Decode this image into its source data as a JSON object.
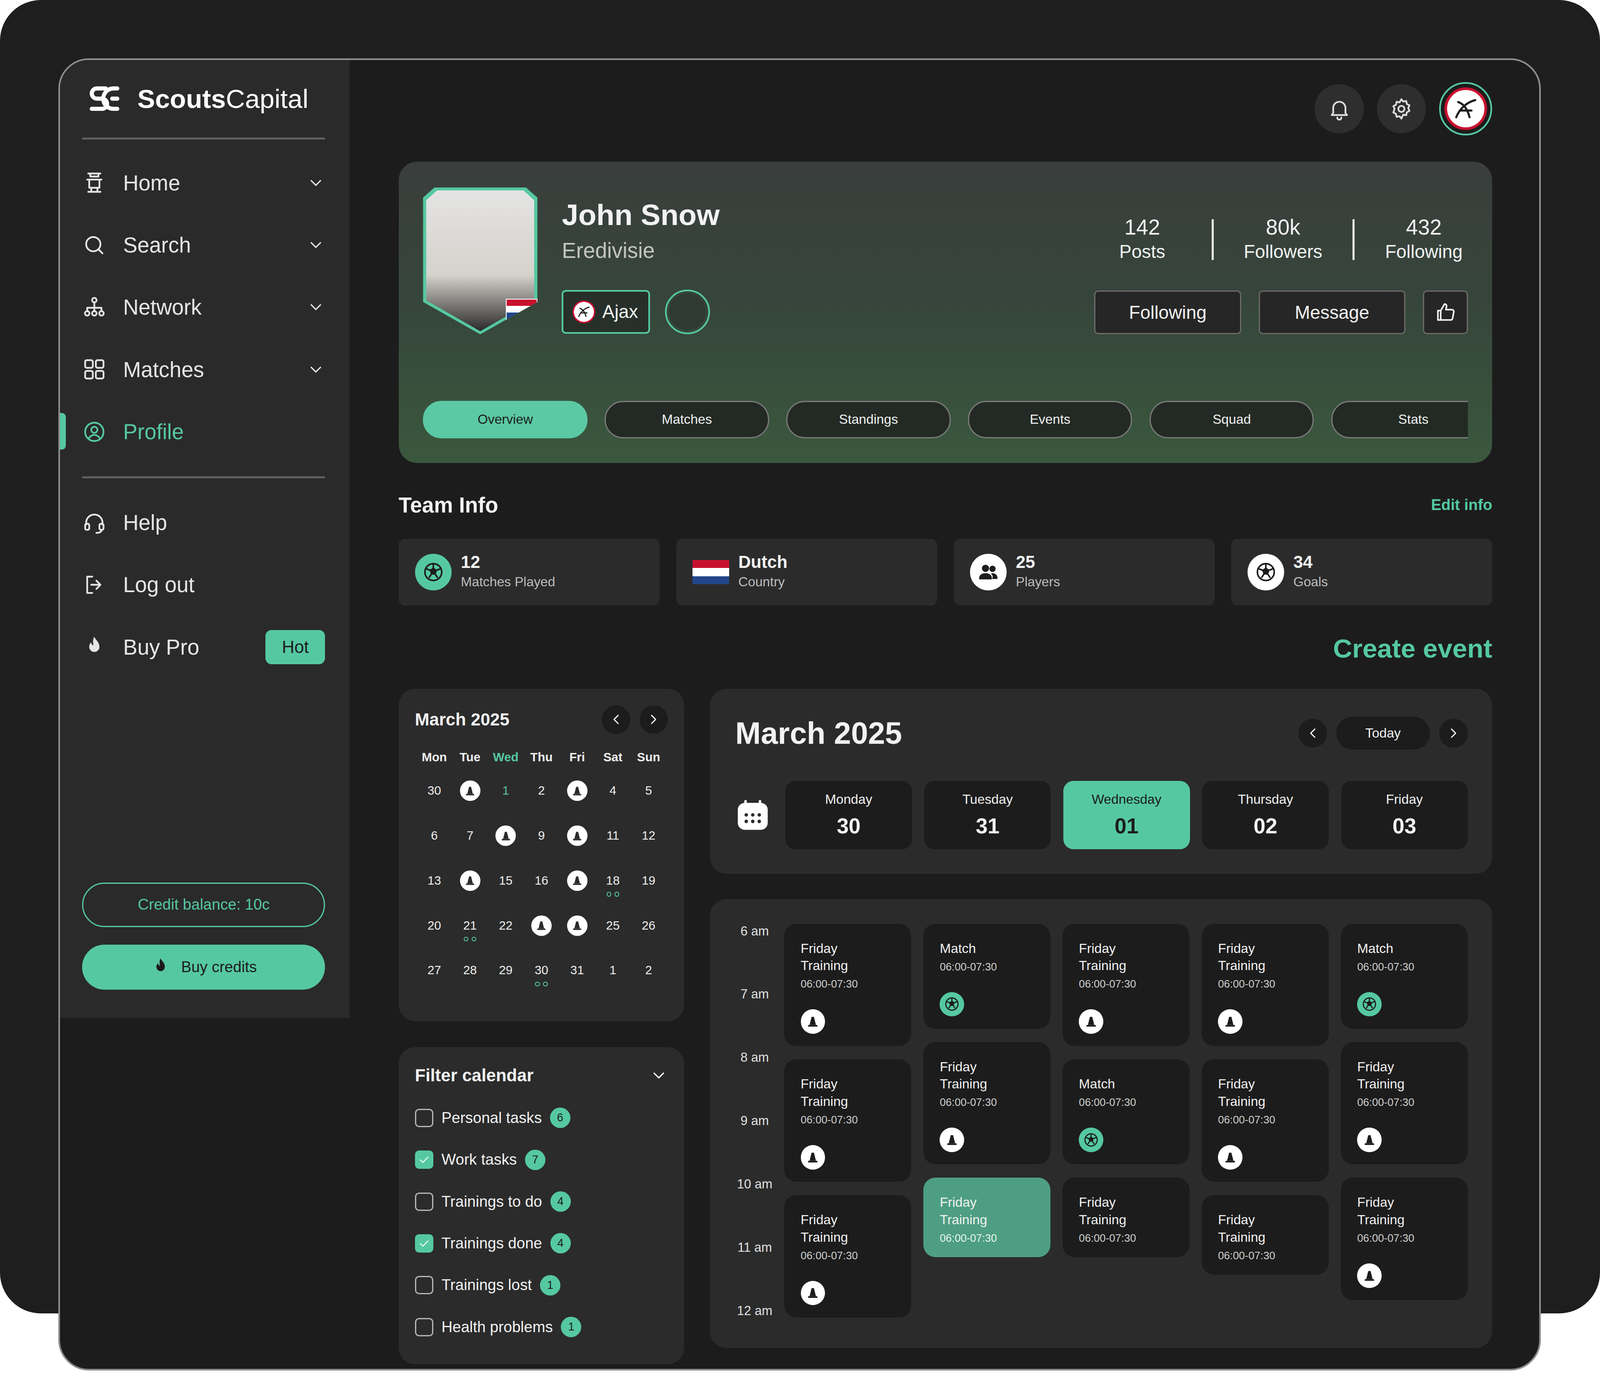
{
  "brand": {
    "bold": "Scouts",
    "light": "Capital"
  },
  "sidebar": {
    "nav": [
      {
        "label": "Home",
        "kind": "menu",
        "selected": false
      },
      {
        "label": "Search",
        "kind": "menu",
        "selected": false
      },
      {
        "label": "Network",
        "kind": "menu",
        "selected": false
      },
      {
        "label": "Matches",
        "kind": "menu",
        "selected": false
      },
      {
        "label": "Profile",
        "kind": "link",
        "selected": true
      }
    ],
    "secondary": [
      {
        "label": "Help"
      },
      {
        "label": "Log out"
      },
      {
        "label": "Buy Pro",
        "badge": "Hot"
      }
    ],
    "credit_balance": "Credit balance: 10c",
    "buy_button": "Buy credits"
  },
  "profile": {
    "name": "John Snow",
    "league": "Eredivisie",
    "club": "Ajax",
    "stats": [
      {
        "value": "142",
        "label": "Posts"
      },
      {
        "value": "80k",
        "label": "Followers"
      },
      {
        "value": "432",
        "label": "Following"
      }
    ],
    "actions": [
      "Following",
      "Message"
    ],
    "tabs": [
      {
        "label": "Overview",
        "selected": true
      },
      {
        "label": "Matches",
        "selected": false
      },
      {
        "label": "Standings",
        "selected": false
      },
      {
        "label": "Events",
        "selected": false
      },
      {
        "label": "Squad",
        "selected": false
      },
      {
        "label": "Stats",
        "selected": false
      }
    ]
  },
  "team_info": {
    "title": "Team Info",
    "edit": "Edit info",
    "cards": [
      {
        "value": "12",
        "label": "Matches Played"
      },
      {
        "value": "Dutch",
        "label": "Country"
      },
      {
        "value": "25",
        "label": "Players"
      },
      {
        "value": "34",
        "label": "Goals"
      }
    ]
  },
  "create_event": "Create event",
  "mini_calendar": {
    "title": "March 2025",
    "weekdays": [
      {
        "label": "Mon",
        "selected": false
      },
      {
        "label": "Tue",
        "selected": false
      },
      {
        "label": "Wed",
        "selected": true
      },
      {
        "label": "Thu",
        "selected": false
      },
      {
        "label": "Fri",
        "selected": false
      },
      {
        "label": "Sat",
        "selected": false
      },
      {
        "label": "Sun",
        "selected": false
      }
    ],
    "weeks": [
      [
        {
          "label": "30",
          "kind": "date",
          "selected": false,
          "dots": false
        },
        {
          "kind": "event",
          "selected": false,
          "dots": false
        },
        {
          "label": "1",
          "kind": "date",
          "selected": true,
          "dots": false
        },
        {
          "label": "2",
          "kind": "date",
          "selected": false,
          "dots": false
        },
        {
          "kind": "event",
          "selected": false,
          "dots": false
        },
        {
          "label": "4",
          "kind": "date",
          "selected": false,
          "dots": false
        },
        {
          "label": "5",
          "kind": "date",
          "selected": false,
          "dots": false
        }
      ],
      [
        {
          "label": "6",
          "kind": "date",
          "selected": false,
          "dots": false
        },
        {
          "label": "7",
          "kind": "date",
          "selected": false,
          "dots": false
        },
        {
          "kind": "event",
          "selected": false,
          "dots": false
        },
        {
          "label": "9",
          "kind": "date",
          "selected": false,
          "dots": false
        },
        {
          "kind": "event",
          "selected": false,
          "dots": false
        },
        {
          "label": "11",
          "kind": "date",
          "selected": false,
          "dots": false
        },
        {
          "label": "12",
          "kind": "date",
          "selected": false,
          "dots": false
        }
      ],
      [
        {
          "label": "13",
          "kind": "date",
          "selected": false,
          "dots": false
        },
        {
          "kind": "event",
          "selected": false,
          "dots": false
        },
        {
          "label": "15",
          "kind": "date",
          "selected": false,
          "dots": false
        },
        {
          "label": "16",
          "kind": "date",
          "selected": false,
          "dots": false
        },
        {
          "kind": "event",
          "selected": false,
          "dots": false
        },
        {
          "label": "18",
          "kind": "date",
          "selected": false,
          "dots": true
        },
        {
          "label": "19",
          "kind": "date",
          "selected": false,
          "dots": false
        }
      ],
      [
        {
          "label": "20",
          "kind": "date",
          "selected": false,
          "dots": false
        },
        {
          "label": "21",
          "kind": "date",
          "selected": false,
          "dots": true
        },
        {
          "label": "22",
          "kind": "date",
          "selected": false,
          "dots": false
        },
        {
          "kind": "event",
          "selected": false,
          "dots": false
        },
        {
          "kind": "event",
          "selected": false,
          "dots": false
        },
        {
          "label": "25",
          "kind": "date",
          "selected": false,
          "dots": false
        },
        {
          "label": "26",
          "kind": "date",
          "selected": false,
          "dots": false
        }
      ],
      [
        {
          "label": "27",
          "kind": "date",
          "selected": false,
          "dots": false
        },
        {
          "label": "28",
          "kind": "date",
          "selected": false,
          "dots": false
        },
        {
          "label": "29",
          "kind": "date",
          "selected": false,
          "dots": false
        },
        {
          "label": "30",
          "kind": "date",
          "selected": false,
          "dots": true
        },
        {
          "label": "31",
          "kind": "date",
          "selected": false,
          "dots": false
        },
        {
          "label": "1",
          "kind": "date",
          "selected": false,
          "dots": false
        },
        {
          "label": "2",
          "kind": "date",
          "selected": false,
          "dots": false
        }
      ]
    ]
  },
  "filters": {
    "title": "Filter calendar",
    "expanded": true,
    "items": [
      {
        "label": "Personal tasks",
        "count": "6",
        "checked": false
      },
      {
        "label": "Work tasks",
        "count": "7",
        "checked": true
      },
      {
        "label": "Trainings to do",
        "count": "4",
        "checked": false
      },
      {
        "label": "Trainings done",
        "count": "4",
        "checked": true
      },
      {
        "label": "Trainings lost",
        "count": "1",
        "checked": false
      },
      {
        "label": "Health problems",
        "count": "1",
        "checked": false
      }
    ]
  },
  "week": {
    "title": "March 2025",
    "today": "Today",
    "days": [
      {
        "weekday": "Monday",
        "date": "30",
        "selected": false
      },
      {
        "weekday": "Tuesday",
        "date": "31",
        "selected": false
      },
      {
        "weekday": "Wednesday",
        "date": "01",
        "selected": true
      },
      {
        "weekday": "Thursday",
        "date": "02",
        "selected": false
      },
      {
        "weekday": "Friday",
        "date": "03",
        "selected": false
      }
    ]
  },
  "schedule": {
    "times": [
      "6 am",
      "7 am",
      "8 am",
      "9 am",
      "10 am",
      "11 am",
      "12 am"
    ],
    "columns": [
      [
        {
          "title": "Friday Training",
          "time": "06:00-07:30",
          "kind": "training",
          "has_icon": true,
          "selected": false
        },
        {
          "title": "Friday Training",
          "time": "06:00-07:30",
          "kind": "training",
          "has_icon": true,
          "selected": false
        },
        {
          "title": "Friday Training",
          "time": "06:00-07:30",
          "kind": "training",
          "has_icon": true,
          "selected": false
        }
      ],
      [
        {
          "title": "Match",
          "time": "06:00-07:30",
          "kind": "match",
          "has_icon": true,
          "selected": false
        },
        {
          "title": "Friday Training",
          "time": "06:00-07:30",
          "kind": "training",
          "has_icon": true,
          "selected": false
        },
        {
          "title": "Friday Training",
          "time": "06:00-07:30",
          "kind": "training",
          "has_icon": false,
          "selected": true
        }
      ],
      [
        {
          "title": "Friday Training",
          "time": "06:00-07:30",
          "kind": "training",
          "has_icon": true,
          "selected": false
        },
        {
          "title": "Match",
          "time": "06:00-07:30",
          "kind": "match",
          "has_icon": true,
          "selected": false
        },
        {
          "title": "Friday Training",
          "time": "06:00-07:30",
          "kind": "training",
          "has_icon": false,
          "selected": false
        }
      ],
      [
        {
          "title": "Friday Training",
          "time": "06:00-07:30",
          "kind": "training",
          "has_icon": true,
          "selected": false
        },
        {
          "title": "Friday Training",
          "time": "06:00-07:30",
          "kind": "training",
          "has_icon": true,
          "selected": false
        },
        {
          "title": "Friday Training",
          "time": "06:00-07:30",
          "kind": "training",
          "has_icon": false,
          "selected": false
        }
      ],
      [
        {
          "title": "Match",
          "time": "06:00-07:30",
          "kind": "match",
          "has_icon": true,
          "selected": false
        },
        {
          "title": "Friday Training",
          "time": "06:00-07:30",
          "kind": "training",
          "has_icon": true,
          "selected": false
        },
        {
          "title": "Friday Training",
          "time": "06:00-07:30",
          "kind": "training",
          "has_icon": true,
          "selected": false
        }
      ]
    ]
  }
}
